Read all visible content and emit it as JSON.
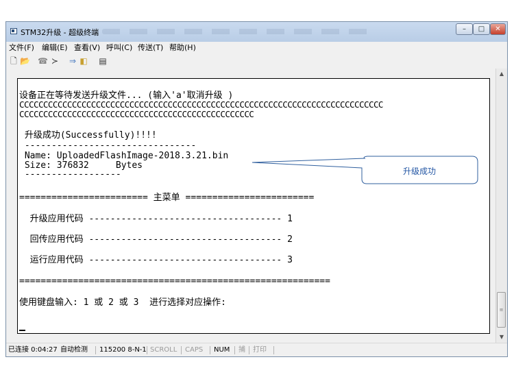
{
  "window": {
    "title": "STM32升级 - 超级终端"
  },
  "menu": [
    "文件(F)",
    "编辑(E)",
    "查看(V)",
    "呼叫(C)",
    "传送(T)",
    "帮助(H)"
  ],
  "toolbar": {
    "icons": [
      "new-file-icon",
      "open-folder-icon",
      "disconnect-icon",
      "connect-icon",
      "send-icon",
      "receive-icon",
      "properties-icon"
    ]
  },
  "terminal": {
    "waiting": "设备正在等待发送升级文件... (输入'a'取消升级 )",
    "c_line_1": "CCCCCCCCCCCCCCCCCCCCCCCCCCCCCCCCCCCCCCCCCCCCCCCCCCCCCCCCCCCCCCCCCCCCCCCCCCCC",
    "c_line_2": "CCCCCCCCCCCCCCCCCCCCCCCCCCCCCCCCCCCCCCCCCCCCCCCCC",
    "success": " 升级成功(Successfully)!!!!",
    "dash_1": " --------------------------------",
    "name_line": " Name: UploadedFlashImage-2018.3.21.bin",
    "size_line": " Size: 376832     Bytes",
    "dash_2": " ------------------",
    "menu_header": "======================== 主菜单 ========================",
    "option_1": "  升级应用代码 ------------------------------------ 1",
    "option_2": "  回传应用代码 ------------------------------------ 2",
    "option_3": "  运行应用代码 ------------------------------------ 3",
    "equals_line": "==========================================================",
    "prompt": "使用键盘输入: 1 或 2 或 3  进行选择对应操作:"
  },
  "callout": {
    "text": "升级成功"
  },
  "status": {
    "connected": "已连接 0:04:27",
    "detect": "自动检测",
    "baud": "115200 8-N-1",
    "scroll": "SCROLL",
    "caps": "CAPS",
    "num": "NUM",
    "capture": "捕",
    "print": "打印"
  },
  "colors": {
    "callout_border": "#2f5f9e",
    "callout_text": "#2356a4"
  }
}
